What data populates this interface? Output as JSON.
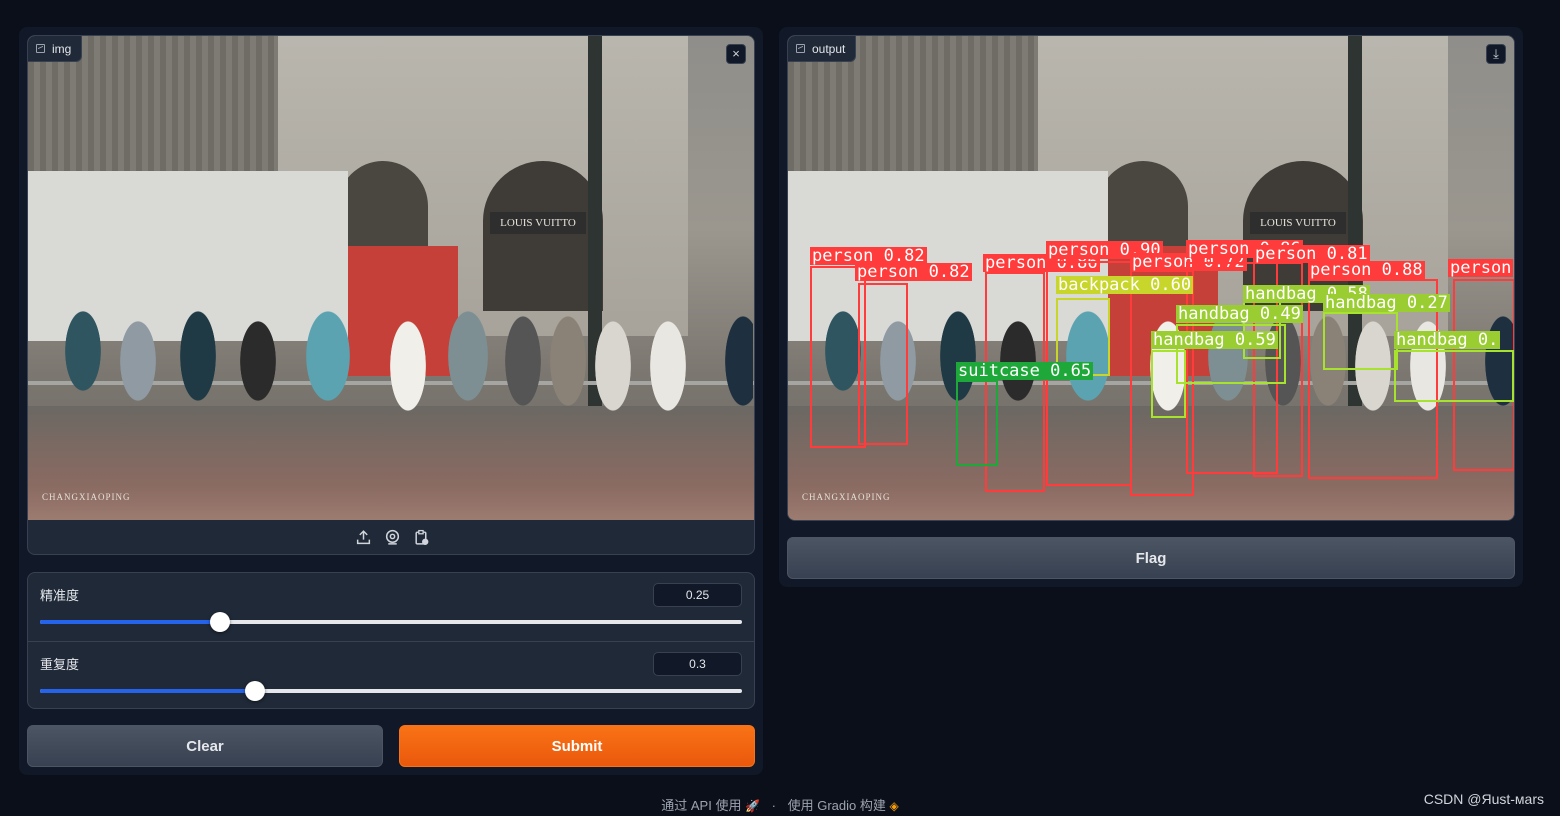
{
  "input_panel": {
    "label": "img",
    "close_symbol": "×",
    "photo_sign": "LOUIS VUITTO",
    "photo_watermark": "CHANGXIAOPING",
    "toolbar_icons": [
      "upload-icon",
      "webcam-icon",
      "clipboard-icon"
    ]
  },
  "output_panel": {
    "label": "output",
    "download_symbol": "⤓",
    "photo_sign": "LOUIS VUITTO",
    "photo_watermark": "CHANGXIAOPING",
    "detections": [
      {
        "label": "person 0.82",
        "color": "#ff3b3b"
      },
      {
        "label": "person 0.82",
        "color": "#ff3b3b"
      },
      {
        "label": "person 0.86",
        "color": "#ff3b3b"
      },
      {
        "label": "person 0.90",
        "color": "#ff3b3b"
      },
      {
        "label": "person 0.72",
        "color": "#ff3b3b"
      },
      {
        "label": "person 0.86",
        "color": "#ff3b3b"
      },
      {
        "label": "person 0.81",
        "color": "#ff3b3b"
      },
      {
        "label": "person 0.88",
        "color": "#ff3b3b"
      },
      {
        "label": "person",
        "color": "#ff3b3b"
      },
      {
        "label": "backpack 0.60",
        "color": "#c8d62b"
      },
      {
        "label": "handbag 0.58",
        "color": "#9acd32"
      },
      {
        "label": "handbag 0.27",
        "color": "#9acd32"
      },
      {
        "label": "handbag 0.49",
        "color": "#9acd32"
      },
      {
        "label": "handbag 0.59",
        "color": "#9acd32"
      },
      {
        "label": "handbag 0.",
        "color": "#9acd32"
      },
      {
        "label": "suitcase 0.65",
        "color": "#1fa83a"
      }
    ]
  },
  "sliders": [
    {
      "label": "精准度",
      "value": "0.25",
      "fraction": 0.257
    },
    {
      "label": "重复度",
      "value": "0.3",
      "fraction": 0.306
    }
  ],
  "buttons": {
    "clear": "Clear",
    "submit": "Submit",
    "flag": "Flag"
  },
  "footer": {
    "api_text": "通过 API 使用",
    "separator": "·",
    "built_text": "使用 Gradio 构建",
    "watermark": "CSDN @Яust-мars"
  },
  "colors": {
    "background": "#0b0f19",
    "panel": "#111827",
    "block": "#1f2937",
    "accent": "#f97316",
    "slider_fill": "#2563eb"
  }
}
